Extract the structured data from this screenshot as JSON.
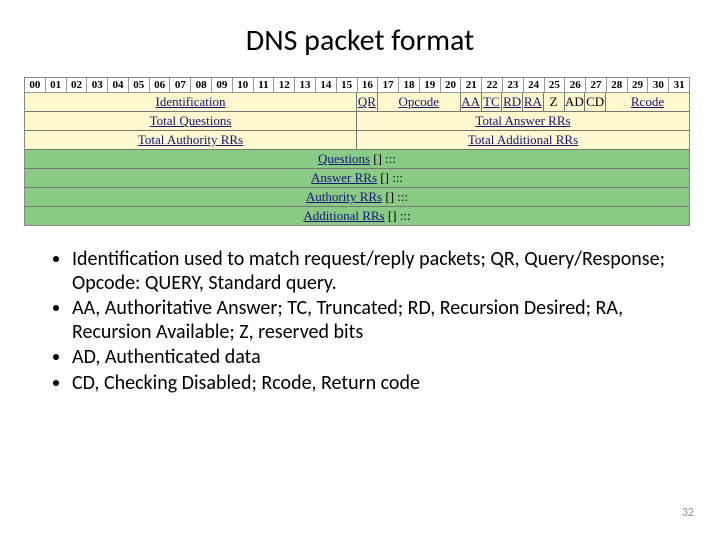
{
  "title": "DNS packet format",
  "bits": [
    "00",
    "01",
    "02",
    "03",
    "04",
    "05",
    "06",
    "07",
    "08",
    "09",
    "10",
    "11",
    "12",
    "13",
    "14",
    "15",
    "16",
    "17",
    "18",
    "19",
    "20",
    "21",
    "22",
    "23",
    "24",
    "25",
    "26",
    "27",
    "28",
    "29",
    "30",
    "31"
  ],
  "row1": {
    "identification": "Identification",
    "qr": "QR",
    "opcode": "Opcode",
    "aa": "AA",
    "tc": "TC",
    "rd": "RD",
    "ra": "RA",
    "z": "Z",
    "ad": "AD",
    "cd": "CD",
    "rcode": "Rcode"
  },
  "row2": {
    "tq": "Total Questions",
    "tar": "Total Answer RRs"
  },
  "row3": {
    "tau": "Total Authority RRs",
    "tad": "Total Additional RRs"
  },
  "body_rows": [
    {
      "label": "Questions",
      "suffix": " [] :::"
    },
    {
      "label": "Answer RRs",
      "suffix": " [] :::"
    },
    {
      "label": "Authority RRs",
      "suffix": " [] :::"
    },
    {
      "label": "Additional RRs",
      "suffix": " [] :::"
    }
  ],
  "bullets": [
    "Identification used to match request/reply packets; QR, Query/Response; Opcode: QUERY, Standard query.",
    "AA, Authoritative Answer; TC, Truncated; RD, Recursion Desired; RA, Recursion Available; Z, reserved bits",
    "AD, Authenticated data",
    "CD, Checking Disabled; Rcode, Return code"
  ],
  "page_number": "32"
}
